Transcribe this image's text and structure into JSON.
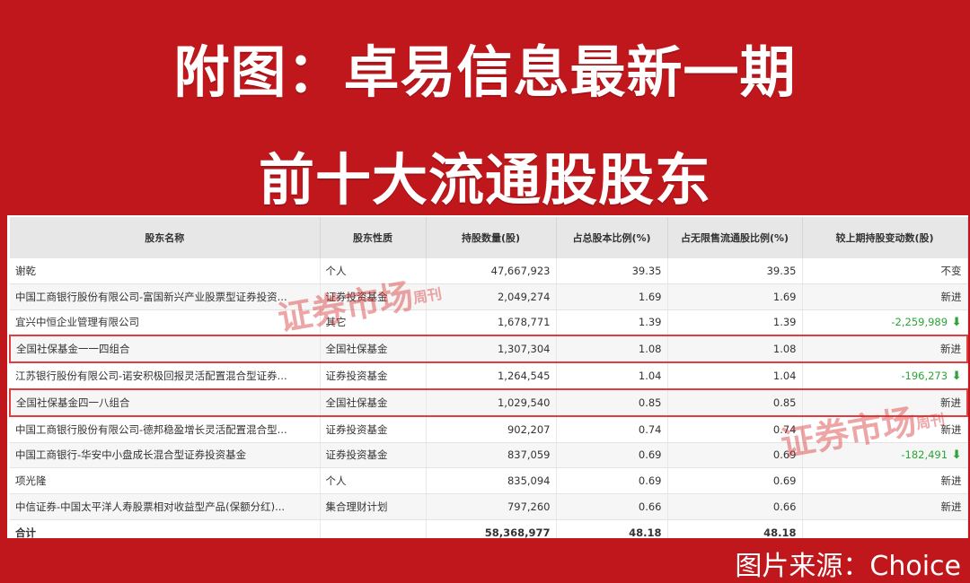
{
  "title_line1": "附图：卓易信息最新一期",
  "title_line2": "前十大流通股股东",
  "table": {
    "headers": [
      "股东名称",
      "股东性质",
      "持股数量(股)",
      "占总股本比例(%)",
      "占无限售流通股比例(%)",
      "较上期持股变动数(股)"
    ],
    "rows": [
      {
        "name": "谢乾",
        "type": "个人",
        "shares": "47,667,923",
        "pct_total": "39.35",
        "pct_float": "39.35",
        "change": "不变",
        "change_dir": ""
      },
      {
        "name": "中国工商银行股份有限公司-富国新兴产业股票型证券投资...",
        "type": "证券投资基金",
        "shares": "2,049,274",
        "pct_total": "1.69",
        "pct_float": "1.69",
        "change": "新进",
        "change_dir": ""
      },
      {
        "name": "宜兴中恒企业管理有限公司",
        "type": "其它",
        "shares": "1,678,771",
        "pct_total": "1.39",
        "pct_float": "1.39",
        "change": "-2,259,989",
        "change_dir": "down"
      },
      {
        "name": "全国社保基金一一四组合",
        "type": "全国社保基金",
        "shares": "1,307,304",
        "pct_total": "1.08",
        "pct_float": "1.08",
        "change": "新进",
        "change_dir": ""
      },
      {
        "name": "江苏银行股份有限公司-诺安积极回报灵活配置混合型证券...",
        "type": "证券投资基金",
        "shares": "1,264,545",
        "pct_total": "1.04",
        "pct_float": "1.04",
        "change": "-196,273",
        "change_dir": "down"
      },
      {
        "name": "全国社保基金四一八组合",
        "type": "全国社保基金",
        "shares": "1,029,540",
        "pct_total": "0.85",
        "pct_float": "0.85",
        "change": "新进",
        "change_dir": ""
      },
      {
        "name": "中国工商银行股份有限公司-德邦稳盈增长灵活配置混合型...",
        "type": "证券投资基金",
        "shares": "902,207",
        "pct_total": "0.74",
        "pct_float": "0.74",
        "change": "新进",
        "change_dir": ""
      },
      {
        "name": "中国工商银行-华安中小盘成长混合型证券投资基金",
        "type": "证券投资基金",
        "shares": "837,059",
        "pct_total": "0.69",
        "pct_float": "0.69",
        "change": "-182,491",
        "change_dir": "down"
      },
      {
        "name": "项光隆",
        "type": "个人",
        "shares": "835,094",
        "pct_total": "0.69",
        "pct_float": "0.69",
        "change": "新进",
        "change_dir": ""
      },
      {
        "name": "中信证券-中国太平洋人寿股票相对收益型产品(保额分红)...",
        "type": "集合理财计划",
        "shares": "797,260",
        "pct_total": "0.66",
        "pct_float": "0.66",
        "change": "新进",
        "change_dir": ""
      }
    ],
    "total": {
      "label": "合计",
      "shares": "58,368,977",
      "pct_total": "48.18",
      "pct_float": "48.18"
    }
  },
  "watermark": {
    "main": "证券市场",
    "side": "周刊"
  },
  "source": "图片来源：Choice",
  "colors": {
    "background": "#c0171c",
    "highlight_border": "#e23c3c",
    "decrease": "#2aa536"
  },
  "arrow_icon": "down-arrow-icon"
}
